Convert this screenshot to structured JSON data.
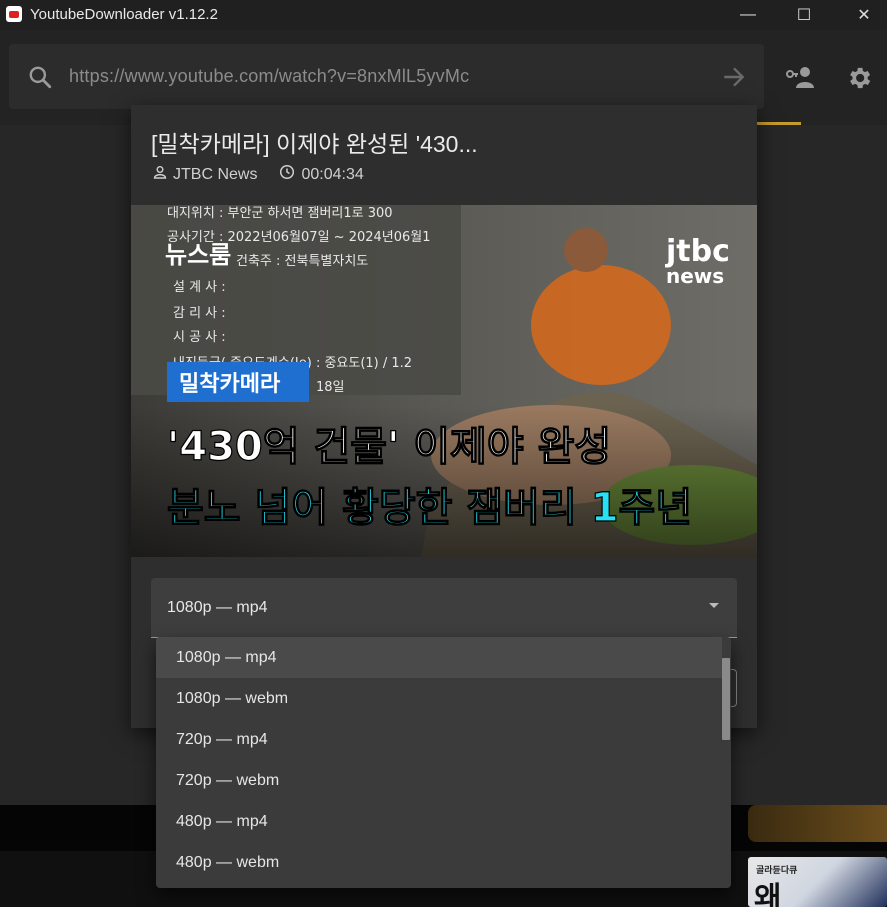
{
  "window": {
    "title": "YoutubeDownloader v1.12.2",
    "controls": {
      "minimize": "—",
      "maximize": "☐",
      "close": "✕"
    }
  },
  "toolbar": {
    "url_value": "https://www.youtube.com/watch?v=8nxMlL5yvMc",
    "icons": [
      "search-icon",
      "arrow-right-icon",
      "auth-icon",
      "gear-icon"
    ]
  },
  "dialog": {
    "title": "[밀착카메라] 이제야 완성된 '430...",
    "channel": "JTBC News",
    "duration": "00:04:34",
    "thumbnail": {
      "overlay_line1": "뉴스룸",
      "brand_top": "jtbc",
      "brand_bottom": "news",
      "tag": "밀착카메라",
      "headline1": "'430억 건물' 이제야 완성",
      "headline2": "분노 넘어 황당한 잼버리 1주년",
      "sign_rows": [
        "대지위치 : 부안군 하서면 잼버리1로 300",
        "공사기간 : 2022년06월07일 ~ 2024년06월1",
        "건축주 : 전북특별자치도",
        "설 계 사 :",
        "감 리 사 :",
        "시 공 사 :",
        "내진등급( 중요도계수(Ie) : 중요도(1) / 1.2",
        "18일"
      ]
    },
    "format_select": {
      "selected": "1080p — mp4",
      "options": [
        "1080p — mp4",
        "1080p — webm",
        "720p — mp4",
        "720p — webm",
        "480p — mp4",
        "480p — webm"
      ]
    }
  },
  "background_thumb": {
    "caption_small": "골라듄다큐",
    "caption_big": "왜"
  },
  "colors": {
    "accent": "#c79a2e",
    "tag_blue": "#1f6fd1",
    "headline_cyan": "#27e0f2"
  }
}
